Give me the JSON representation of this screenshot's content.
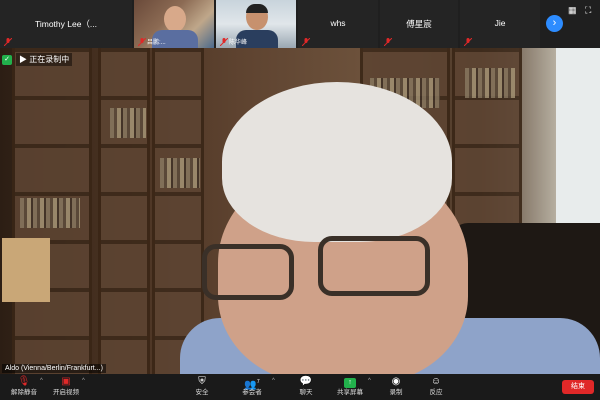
{
  "participants_strip": {
    "tiles": [
      {
        "name": "Timothy  Lee（...",
        "muted": true
      },
      {
        "name": "",
        "label": "吕鹏:...",
        "video": true
      },
      {
        "name": "",
        "label": "陈华峰",
        "video": true
      },
      {
        "name": "whs",
        "muted": true
      },
      {
        "name": "傅星宸",
        "muted": true
      },
      {
        "name": "Jie",
        "muted": true
      }
    ],
    "next_icon": "chevron-right-icon",
    "grid_icon": "grid-icon",
    "fullscreen_icon": "fullscreen-icon"
  },
  "main_video": {
    "security_badge": "shield-icon",
    "recording_text": "▶ 正在录制中",
    "speaker_name": "Aldo (Vienna/Berlin/Frankfurt...)"
  },
  "toolbar": {
    "items": [
      {
        "icon": "mic-icon",
        "label": "解除静音"
      },
      {
        "icon": "video-off-icon",
        "label": "开启视频"
      },
      {
        "icon": "shield-icon",
        "label": "安全"
      },
      {
        "icon": "participants-icon",
        "label": "参会者",
        "count": "7"
      },
      {
        "icon": "chat-icon",
        "label": "聊天"
      },
      {
        "icon": "share-screen-icon",
        "label": "共享屏幕"
      },
      {
        "icon": "record-icon",
        "label": "录制"
      },
      {
        "icon": "reactions-icon",
        "label": "反应"
      }
    ],
    "end_label": "结束",
    "colors": {
      "share": "#22b14c",
      "end": "#e02828",
      "accent": "#2d8cff"
    }
  }
}
